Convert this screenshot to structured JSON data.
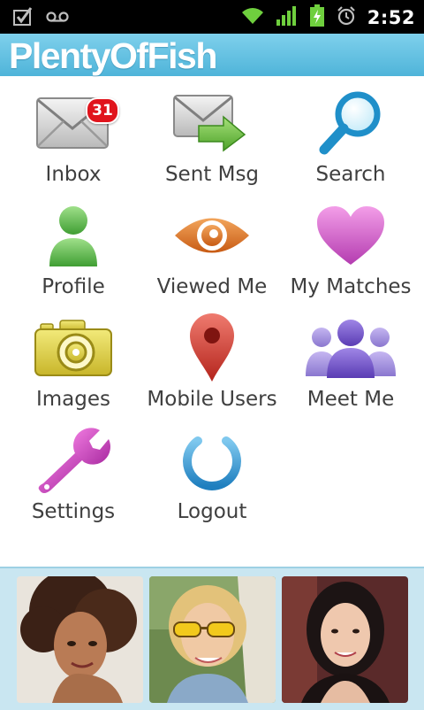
{
  "status_bar": {
    "time": "2:52",
    "icons": [
      "checkbox-icon",
      "voicemail-icon",
      "wifi-icon",
      "signal-icon",
      "battery-charging-icon",
      "alarm-icon"
    ]
  },
  "header": {
    "logo_text": "PlentyOfFish"
  },
  "menu": {
    "inbox": {
      "label": "Inbox",
      "badge": "31"
    },
    "sent": {
      "label": "Sent Msg"
    },
    "search": {
      "label": "Search"
    },
    "profile": {
      "label": "Profile"
    },
    "viewed": {
      "label": "Viewed Me"
    },
    "matches": {
      "label": "My Matches"
    },
    "images": {
      "label": "Images"
    },
    "mobile": {
      "label": "Mobile Users"
    },
    "meet": {
      "label": "Meet Me"
    },
    "settings": {
      "label": "Settings"
    },
    "logout": {
      "label": "Logout"
    }
  },
  "colors": {
    "header": "#5bbcdf",
    "badge": "#e0141c",
    "strip": "#c9e6f1"
  }
}
